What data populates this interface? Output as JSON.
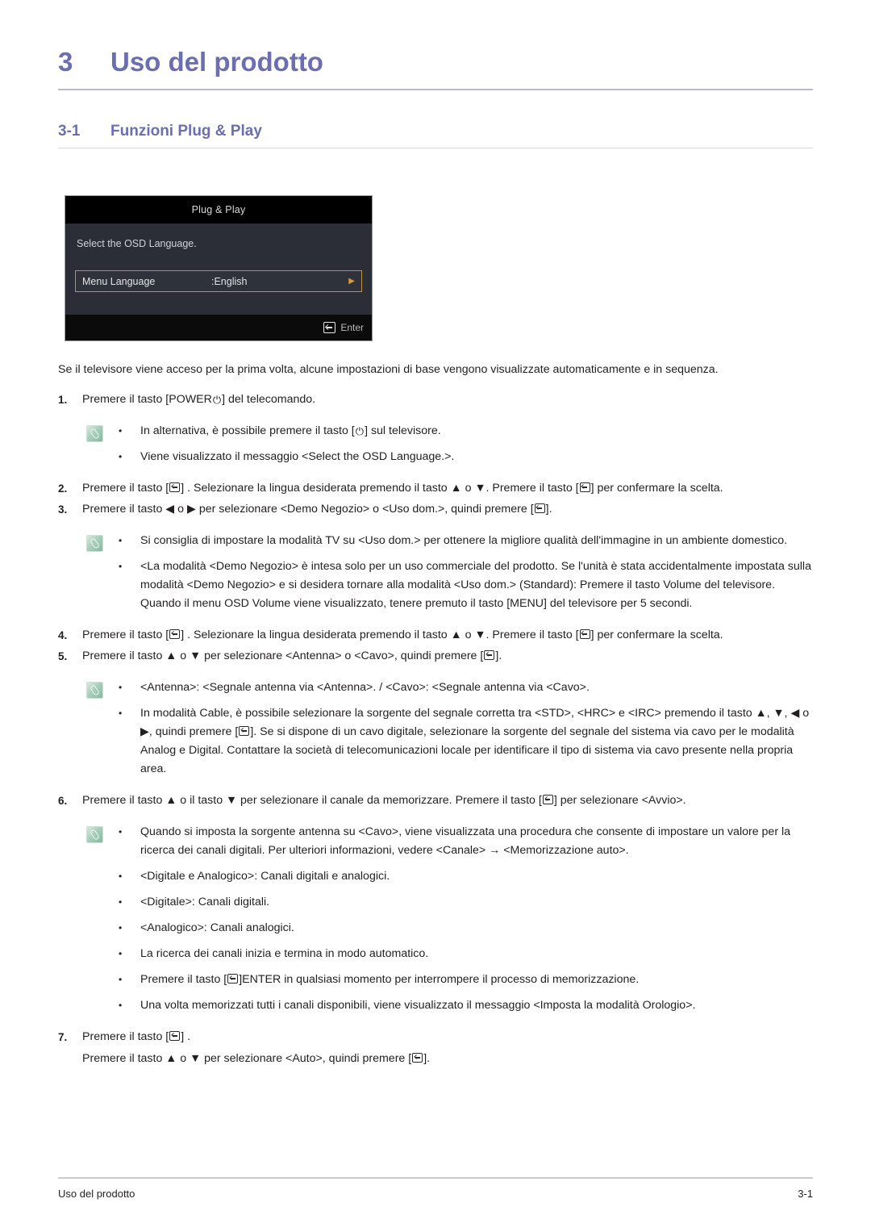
{
  "chapter": {
    "number": "3",
    "title": "Uso del prodotto"
  },
  "section": {
    "number": "3-1",
    "title": "Funzioni Plug & Play"
  },
  "osd": {
    "title": "Plug & Play",
    "prompt": "Select the OSD Language.",
    "row_label": "Menu Language",
    "row_value": ":English",
    "row_arrow": "▶",
    "footer_label": "Enter",
    "enter_icon": "enter-key-icon",
    "colors": {
      "titlebar_bg": "#000000",
      "body_bg": "#2b2e36",
      "highlight_border": "#c08f42",
      "footer_bg": "#0b0b0c"
    }
  },
  "intro": "Se il televisore viene acceso per la prima volta, alcune impostazioni di base vengono visualizzate automaticamente e in sequenza.",
  "steps": {
    "s1": {
      "num": "1.",
      "a": "Premere il tasto [POWER",
      "b": "] del telecomando."
    },
    "s2": {
      "num": "2.",
      "a": "Premere il tasto [",
      "b": "] . Selezionare la lingua desiderata premendo il tasto ▲ o ▼. Premere il tasto [",
      "c": "] per confermare la scelta."
    },
    "s3": {
      "num": "3.",
      "a": "Premere il tasto ◀ o ▶ per selezionare <Demo Negozio> o <Uso dom.>, quindi premere [",
      "b": "]."
    },
    "s4": {
      "num": "4.",
      "a": "Premere il tasto [",
      "b": "] . Selezionare la lingua desiderata premendo il tasto ▲ o ▼. Premere il tasto [",
      "c": "] per confermare la scelta."
    },
    "s5": {
      "num": "5.",
      "a": "Premere il tasto ▲ o ▼ per selezionare <Antenna> o <Cavo>, quindi premere [",
      "b": "]."
    },
    "s6": {
      "num": "6.",
      "a": "Premere il tasto ▲ o il tasto ▼ per selezionare il canale da memorizzare. Premere il tasto [",
      "b": "] per selezionare <Avvio>."
    },
    "s7": {
      "num": "7.",
      "a": "Premere il tasto [",
      "b": "] .",
      "sub_a": "Premere il tasto ▲ o ▼ per selezionare <Auto>, quindi premere [",
      "sub_b": "]."
    }
  },
  "notes": {
    "note1": {
      "icon": "note-paperclip-icon",
      "items": [
        {
          "bullet": "•",
          "a": "In alternativa, è possibile premere il tasto [",
          "b": "] sul televisore."
        },
        {
          "bullet": "•",
          "text": "Viene visualizzato il messaggio <Select the OSD Language.>."
        }
      ]
    },
    "note2": {
      "icon": "note-paperclip-icon",
      "items": [
        {
          "bullet": "•",
          "text": "Si consiglia di impostare la modalità TV su <Uso dom.> per ottenere la migliore qualità dell'immagine in un ambiente domestico."
        },
        {
          "bullet": "•",
          "text": "<La modalità <Demo Negozio> è intesa solo per un uso commerciale del prodotto. Se l'unità è stata accidentalmente impostata sulla modalità <Demo Negozio> e si desidera tornare alla modalità <Uso dom.> (Standard): Premere il tasto Volume del televisore. Quando il menu OSD Volume viene visualizzato, tenere premuto il tasto [MENU] del televisore per 5 secondi."
        }
      ]
    },
    "note3": {
      "icon": "note-paperclip-icon",
      "items": [
        {
          "bullet": "•",
          "text": "<Antenna>: <Segnale antenna via <Antenna>. / <Cavo>: <Segnale antenna via <Cavo>."
        },
        {
          "bullet": "•",
          "a": "In modalità Cable, è possibile selezionare la sorgente del segnale corretta tra <STD>, <HRC> e <IRC> premendo il tasto ▲, ▼, ◀ o ▶, quindi premere [",
          "b": "]. Se si dispone di un cavo digitale, selezionare la sorgente del segnale del sistema via cavo per le modalità Analog e Digital. Contattare la società di telecomunicazioni locale per identificare il tipo di sistema via cavo presente nella propria area."
        }
      ]
    },
    "note4": {
      "icon": "note-paperclip-icon",
      "items": [
        {
          "bullet": "•",
          "text": "Quando si imposta la sorgente antenna su <Cavo>, viene visualizzata una procedura che consente di impostare un valore per la ricerca dei canali digitali. Per ulteriori informazioni, vedere <Canale> → <Memorizzazione auto>."
        },
        {
          "bullet": "•",
          "text": "<Digitale e Analogico>: Canali digitali e analogici."
        },
        {
          "bullet": "•",
          "text": "<Digitale>: Canali digitali."
        },
        {
          "bullet": "•",
          "text": "<Analogico>: Canali analogici."
        },
        {
          "bullet": "•",
          "text": "La ricerca dei canali inizia e termina in modo automatico."
        },
        {
          "bullet": "•",
          "a": "Premere il tasto [",
          "b": "]ENTER in qualsiasi momento per interrompere il processo di memorizzazione."
        },
        {
          "bullet": "•",
          "text": "Una volta memorizzati tutti i canali disponibili, viene visualizzato il messaggio <Imposta la modalità Orologio>."
        }
      ]
    }
  },
  "footer": {
    "left": "Uso del prodotto",
    "right": "3-1"
  }
}
